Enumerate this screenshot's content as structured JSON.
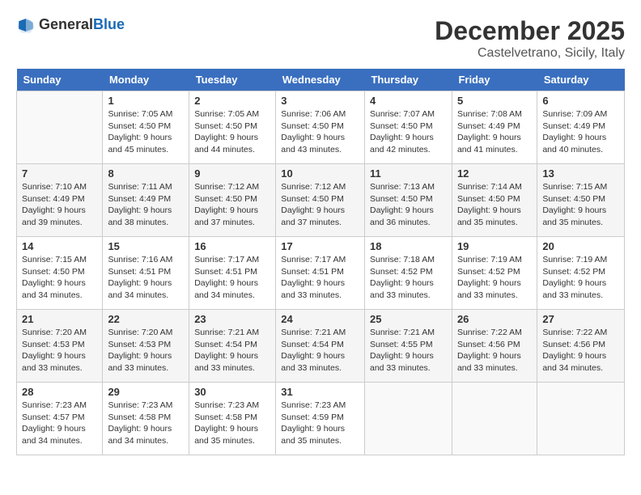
{
  "header": {
    "logo_general": "General",
    "logo_blue": "Blue",
    "month_title": "December 2025",
    "location": "Castelvetrano, Sicily, Italy"
  },
  "weekdays": [
    "Sunday",
    "Monday",
    "Tuesday",
    "Wednesday",
    "Thursday",
    "Friday",
    "Saturday"
  ],
  "weeks": [
    [
      {
        "day": "",
        "sunrise": "",
        "sunset": "",
        "daylight": ""
      },
      {
        "day": "1",
        "sunrise": "Sunrise: 7:05 AM",
        "sunset": "Sunset: 4:50 PM",
        "daylight": "Daylight: 9 hours and 45 minutes."
      },
      {
        "day": "2",
        "sunrise": "Sunrise: 7:05 AM",
        "sunset": "Sunset: 4:50 PM",
        "daylight": "Daylight: 9 hours and 44 minutes."
      },
      {
        "day": "3",
        "sunrise": "Sunrise: 7:06 AM",
        "sunset": "Sunset: 4:50 PM",
        "daylight": "Daylight: 9 hours and 43 minutes."
      },
      {
        "day": "4",
        "sunrise": "Sunrise: 7:07 AM",
        "sunset": "Sunset: 4:50 PM",
        "daylight": "Daylight: 9 hours and 42 minutes."
      },
      {
        "day": "5",
        "sunrise": "Sunrise: 7:08 AM",
        "sunset": "Sunset: 4:49 PM",
        "daylight": "Daylight: 9 hours and 41 minutes."
      },
      {
        "day": "6",
        "sunrise": "Sunrise: 7:09 AM",
        "sunset": "Sunset: 4:49 PM",
        "daylight": "Daylight: 9 hours and 40 minutes."
      }
    ],
    [
      {
        "day": "7",
        "sunrise": "Sunrise: 7:10 AM",
        "sunset": "Sunset: 4:49 PM",
        "daylight": "Daylight: 9 hours and 39 minutes."
      },
      {
        "day": "8",
        "sunrise": "Sunrise: 7:11 AM",
        "sunset": "Sunset: 4:49 PM",
        "daylight": "Daylight: 9 hours and 38 minutes."
      },
      {
        "day": "9",
        "sunrise": "Sunrise: 7:12 AM",
        "sunset": "Sunset: 4:50 PM",
        "daylight": "Daylight: 9 hours and 37 minutes."
      },
      {
        "day": "10",
        "sunrise": "Sunrise: 7:12 AM",
        "sunset": "Sunset: 4:50 PM",
        "daylight": "Daylight: 9 hours and 37 minutes."
      },
      {
        "day": "11",
        "sunrise": "Sunrise: 7:13 AM",
        "sunset": "Sunset: 4:50 PM",
        "daylight": "Daylight: 9 hours and 36 minutes."
      },
      {
        "day": "12",
        "sunrise": "Sunrise: 7:14 AM",
        "sunset": "Sunset: 4:50 PM",
        "daylight": "Daylight: 9 hours and 35 minutes."
      },
      {
        "day": "13",
        "sunrise": "Sunrise: 7:15 AM",
        "sunset": "Sunset: 4:50 PM",
        "daylight": "Daylight: 9 hours and 35 minutes."
      }
    ],
    [
      {
        "day": "14",
        "sunrise": "Sunrise: 7:15 AM",
        "sunset": "Sunset: 4:50 PM",
        "daylight": "Daylight: 9 hours and 34 minutes."
      },
      {
        "day": "15",
        "sunrise": "Sunrise: 7:16 AM",
        "sunset": "Sunset: 4:51 PM",
        "daylight": "Daylight: 9 hours and 34 minutes."
      },
      {
        "day": "16",
        "sunrise": "Sunrise: 7:17 AM",
        "sunset": "Sunset: 4:51 PM",
        "daylight": "Daylight: 9 hours and 34 minutes."
      },
      {
        "day": "17",
        "sunrise": "Sunrise: 7:17 AM",
        "sunset": "Sunset: 4:51 PM",
        "daylight": "Daylight: 9 hours and 33 minutes."
      },
      {
        "day": "18",
        "sunrise": "Sunrise: 7:18 AM",
        "sunset": "Sunset: 4:52 PM",
        "daylight": "Daylight: 9 hours and 33 minutes."
      },
      {
        "day": "19",
        "sunrise": "Sunrise: 7:19 AM",
        "sunset": "Sunset: 4:52 PM",
        "daylight": "Daylight: 9 hours and 33 minutes."
      },
      {
        "day": "20",
        "sunrise": "Sunrise: 7:19 AM",
        "sunset": "Sunset: 4:52 PM",
        "daylight": "Daylight: 9 hours and 33 minutes."
      }
    ],
    [
      {
        "day": "21",
        "sunrise": "Sunrise: 7:20 AM",
        "sunset": "Sunset: 4:53 PM",
        "daylight": "Daylight: 9 hours and 33 minutes."
      },
      {
        "day": "22",
        "sunrise": "Sunrise: 7:20 AM",
        "sunset": "Sunset: 4:53 PM",
        "daylight": "Daylight: 9 hours and 33 minutes."
      },
      {
        "day": "23",
        "sunrise": "Sunrise: 7:21 AM",
        "sunset": "Sunset: 4:54 PM",
        "daylight": "Daylight: 9 hours and 33 minutes."
      },
      {
        "day": "24",
        "sunrise": "Sunrise: 7:21 AM",
        "sunset": "Sunset: 4:54 PM",
        "daylight": "Daylight: 9 hours and 33 minutes."
      },
      {
        "day": "25",
        "sunrise": "Sunrise: 7:21 AM",
        "sunset": "Sunset: 4:55 PM",
        "daylight": "Daylight: 9 hours and 33 minutes."
      },
      {
        "day": "26",
        "sunrise": "Sunrise: 7:22 AM",
        "sunset": "Sunset: 4:56 PM",
        "daylight": "Daylight: 9 hours and 33 minutes."
      },
      {
        "day": "27",
        "sunrise": "Sunrise: 7:22 AM",
        "sunset": "Sunset: 4:56 PM",
        "daylight": "Daylight: 9 hours and 34 minutes."
      }
    ],
    [
      {
        "day": "28",
        "sunrise": "Sunrise: 7:23 AM",
        "sunset": "Sunset: 4:57 PM",
        "daylight": "Daylight: 9 hours and 34 minutes."
      },
      {
        "day": "29",
        "sunrise": "Sunrise: 7:23 AM",
        "sunset": "Sunset: 4:58 PM",
        "daylight": "Daylight: 9 hours and 34 minutes."
      },
      {
        "day": "30",
        "sunrise": "Sunrise: 7:23 AM",
        "sunset": "Sunset: 4:58 PM",
        "daylight": "Daylight: 9 hours and 35 minutes."
      },
      {
        "day": "31",
        "sunrise": "Sunrise: 7:23 AM",
        "sunset": "Sunset: 4:59 PM",
        "daylight": "Daylight: 9 hours and 35 minutes."
      },
      {
        "day": "",
        "sunrise": "",
        "sunset": "",
        "daylight": ""
      },
      {
        "day": "",
        "sunrise": "",
        "sunset": "",
        "daylight": ""
      },
      {
        "day": "",
        "sunrise": "",
        "sunset": "",
        "daylight": ""
      }
    ]
  ]
}
